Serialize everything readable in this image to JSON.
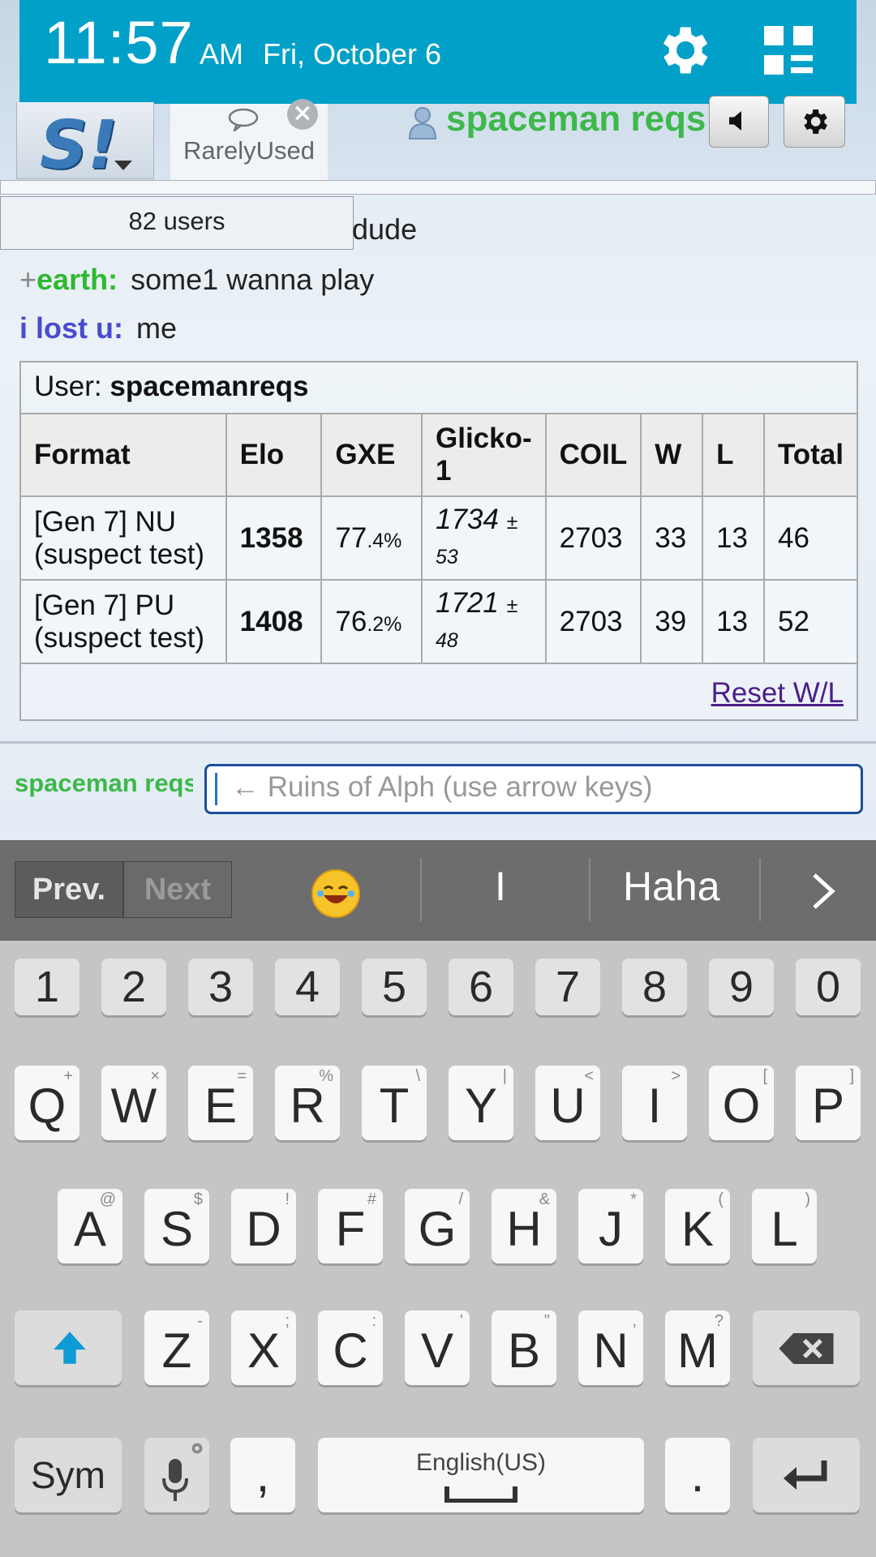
{
  "status_bar": {
    "time": "11:57",
    "ampm": "AM",
    "date": "Fri, October 6"
  },
  "header": {
    "logo": "S!",
    "room_tab": "RarelyUsed",
    "username": "spaceman reqs"
  },
  "chat": {
    "users_count": "82 users",
    "fragment": "dude",
    "messages": [
      {
        "rank": "+",
        "name": "earth:",
        "name_color": "#2fb82f",
        "text": "some1 wanna play"
      },
      {
        "rank": "",
        "name": "i lost u:",
        "name_color": "#4a4ad0",
        "text": "me"
      }
    ]
  },
  "ranking": {
    "user_label": "User: ",
    "user": "spacemanreqs",
    "headers": [
      "Format",
      "Elo",
      "GXE",
      "Glicko-1",
      "COIL",
      "W",
      "L",
      "Total"
    ],
    "rows": [
      {
        "format": "[Gen 7] NU (suspect test)",
        "elo": "1358",
        "gxe": "77",
        "gxe_dec": ".4%",
        "glicko": "1734",
        "glicko_dev": "± 53",
        "coil": "2703",
        "w": "33",
        "l": "13",
        "total": "46"
      },
      {
        "format": "[Gen 7] PU (suspect test)",
        "elo": "1408",
        "gxe": "76",
        "gxe_dec": ".2%",
        "glicko": "1721",
        "glicko_dev": "± 48",
        "coil": "2703",
        "w": "39",
        "l": "13",
        "total": "52"
      }
    ],
    "reset_link": "Reset W/L"
  },
  "composer": {
    "name": "spaceman reqs",
    "placeholder": "← Ruins of Alph (use arrow keys)"
  },
  "keyboard": {
    "prev": "Prev.",
    "next": "Next",
    "suggestions": [
      "I",
      "Haha"
    ],
    "numbers": [
      "1",
      "2",
      "3",
      "4",
      "5",
      "6",
      "7",
      "8",
      "9",
      "0"
    ],
    "row1": [
      [
        "Q",
        "+"
      ],
      [
        "W",
        "×"
      ],
      [
        "E",
        "="
      ],
      [
        "R",
        "%"
      ],
      [
        "T",
        "\\"
      ],
      [
        "Y",
        "|"
      ],
      [
        "U",
        "<"
      ],
      [
        "I",
        ">"
      ],
      [
        "O",
        "["
      ],
      [
        "P",
        "]"
      ]
    ],
    "row2": [
      [
        "A",
        "@"
      ],
      [
        "S",
        "$"
      ],
      [
        "D",
        "!"
      ],
      [
        "F",
        "#"
      ],
      [
        "G",
        "/"
      ],
      [
        "H",
        "&"
      ],
      [
        "J",
        "*"
      ],
      [
        "K",
        "("
      ],
      [
        "L",
        ")"
      ]
    ],
    "row3": [
      [
        "Z",
        "-"
      ],
      [
        "X",
        ";"
      ],
      [
        "C",
        ":"
      ],
      [
        "V",
        "'"
      ],
      [
        "B",
        "\""
      ],
      [
        "N",
        ","
      ],
      [
        "M",
        "?"
      ]
    ],
    "sym": "Sym",
    "comma": ",",
    "space": "English(US)",
    "period": "."
  }
}
